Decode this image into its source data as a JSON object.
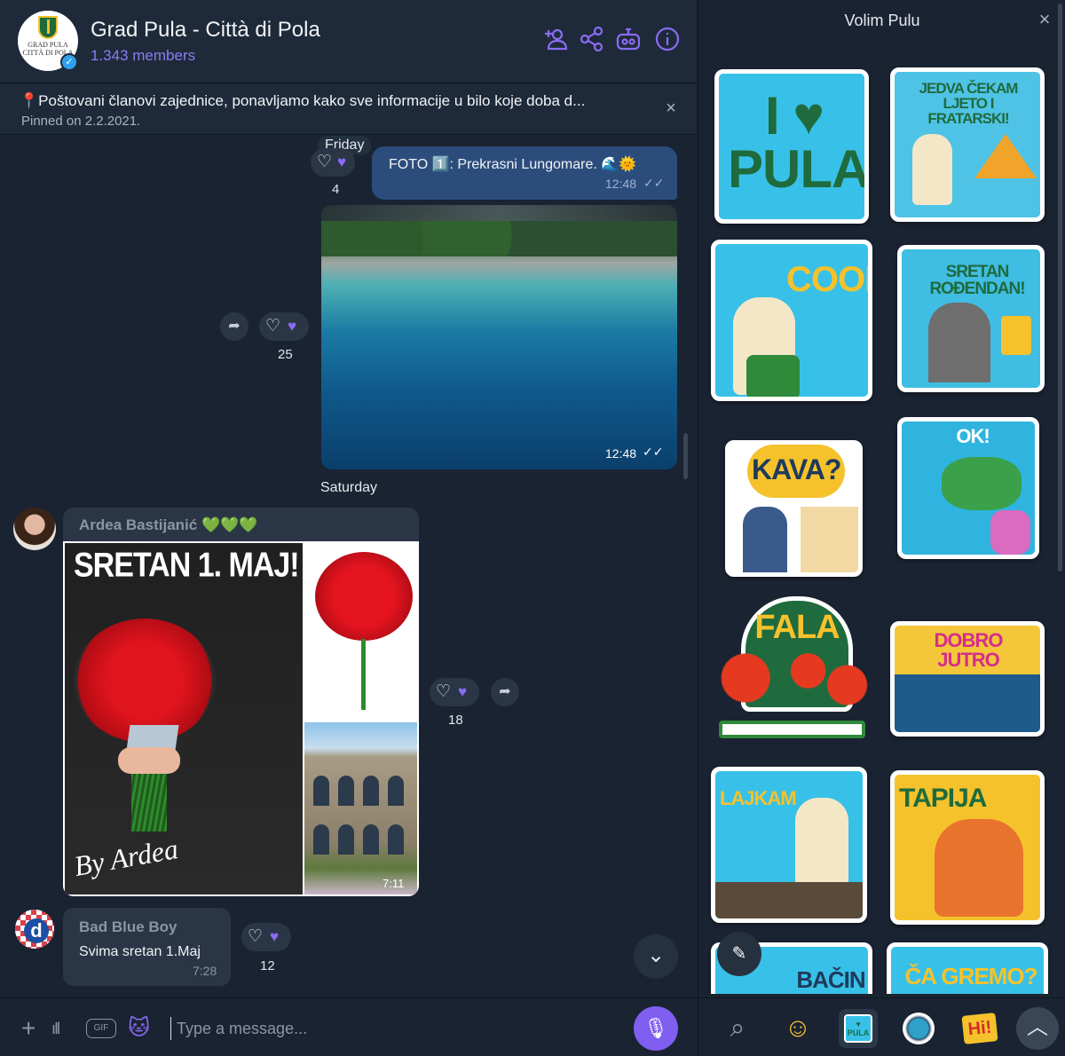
{
  "header": {
    "group_name": "Grad Pula - Città di Pola",
    "members": "1.343 members",
    "avatar_text": "GRAD PULA\nCITTÀ DI POLA"
  },
  "pinned": {
    "text": "📍Poštovani članovi zajednice, ponavljamo kako sve informacije u bilo koje doba d...",
    "date": "Pinned on 2.2.2021."
  },
  "messages": {
    "friday_label": "Friday",
    "msg1": {
      "text": "FOTO 1️⃣: Prekrasni Lungomare. 🌊🌞",
      "time": "12:48",
      "reactions": "4"
    },
    "photo": {
      "time": "12:48",
      "reactions": "25"
    },
    "saturday_label": "Saturday",
    "ardea": {
      "name": "Ardea Bastijanić 💚💚💚",
      "collage_title": "SRETAN 1. MAJ!",
      "collage_signature": "By Ardea",
      "time": "7:11",
      "reactions": "18"
    },
    "bbb": {
      "name": "Bad Blue Boy",
      "text": "Svima sretan 1.Maj",
      "time": "7:28",
      "reactions": "12"
    }
  },
  "composer": {
    "placeholder": "Type a message..."
  },
  "sticker_panel": {
    "title": "Volim Pulu",
    "stickers": [
      {
        "label": "I ♥ PULA"
      },
      {
        "label": "JEDVA ČEKAM LJETO I FRATARSKI!"
      },
      {
        "label": "COOL!"
      },
      {
        "label": "SRETAN ROĐENDAN!"
      },
      {
        "label": "KAVA?"
      },
      {
        "label": "OK!"
      },
      {
        "label": "FALA"
      },
      {
        "label": "DOBRO JUTRO"
      },
      {
        "label": "LAJKAM"
      },
      {
        "label": "TAPIJA"
      },
      {
        "label": "BAČIN"
      },
      {
        "label": "ČA GREMO?"
      }
    ],
    "tabs": [
      "search",
      "emoji",
      "volim-pulu",
      "pack-4",
      "hi"
    ],
    "hi_label": "Hi!"
  },
  "colors": {
    "accent": "#8b6cf5",
    "bubble_out": "#2c4d7c",
    "bubble_in": "#2a3646",
    "background": "#1a2332"
  }
}
